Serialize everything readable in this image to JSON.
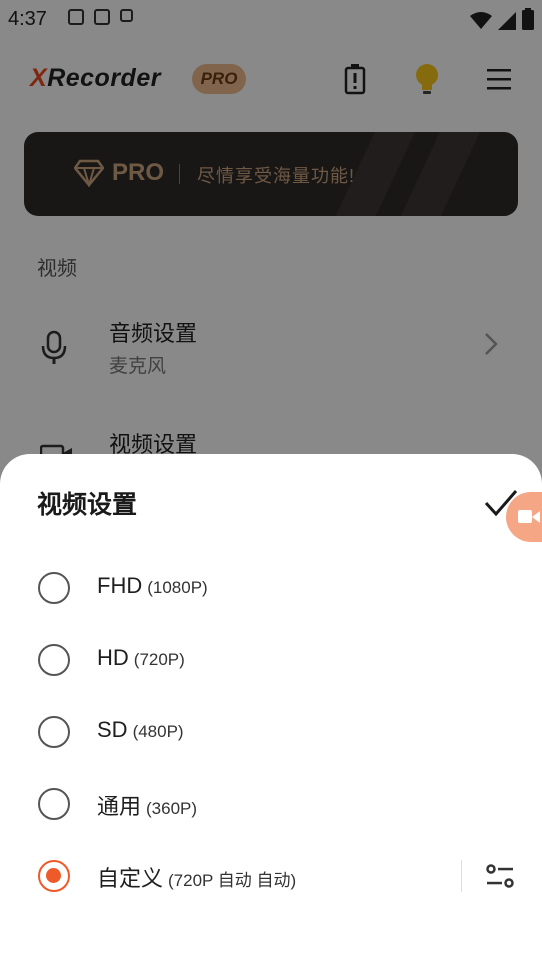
{
  "status": {
    "time": "4:37"
  },
  "app": {
    "logo_x": "X",
    "logo_rest": "Recorder",
    "pro_badge": "PRO"
  },
  "banner": {
    "pro": "PRO",
    "text": "尽情享受海量功能!"
  },
  "section": {
    "label": "视频"
  },
  "rows": [
    {
      "title": "音频设置",
      "subtitle": "麦克风"
    },
    {
      "title": "视频设置"
    }
  ],
  "sheet": {
    "title": "视频设置",
    "options": [
      {
        "name": "FHD",
        "res": "(1080P)",
        "selected": false
      },
      {
        "name": "HD",
        "res": "(720P)",
        "selected": false
      },
      {
        "name": "SD",
        "res": "(480P)",
        "selected": false
      },
      {
        "name": "通用",
        "res": "(360P)",
        "selected": false
      },
      {
        "name": "自定义",
        "res": "(720P 自动 自动)",
        "selected": true
      }
    ]
  },
  "colors": {
    "accent": "#ef5a2a",
    "logo_x": "#e8461e",
    "pro_chip": "#e9b88a",
    "banner_bg": "#2f2a27"
  },
  "icons": [
    "battery-alert-icon",
    "lightbulb-icon",
    "menu-icon",
    "microphone-icon",
    "video-camera-icon",
    "chevron-right-icon",
    "check-icon",
    "tune-settings-icon"
  ]
}
